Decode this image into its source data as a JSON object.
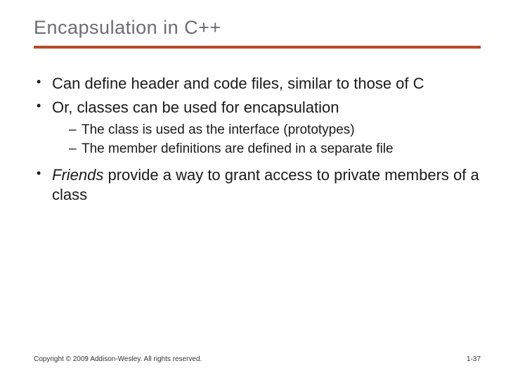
{
  "title": "Encapsulation in C++",
  "bullets": {
    "b1": "Can define header and code files, similar to those of C",
    "b2": "Or, classes can be used for encapsulation",
    "b2_sub1": "The class is used as the interface (prototypes)",
    "b2_sub2": "The member definitions are defined in a separate file",
    "b3_italic": "Friends",
    "b3_rest": " provide a way to grant access to private members of a class"
  },
  "footer": {
    "copyright": "Copyright © 2009 Addison-Wesley. All rights reserved.",
    "page": "1-37"
  }
}
